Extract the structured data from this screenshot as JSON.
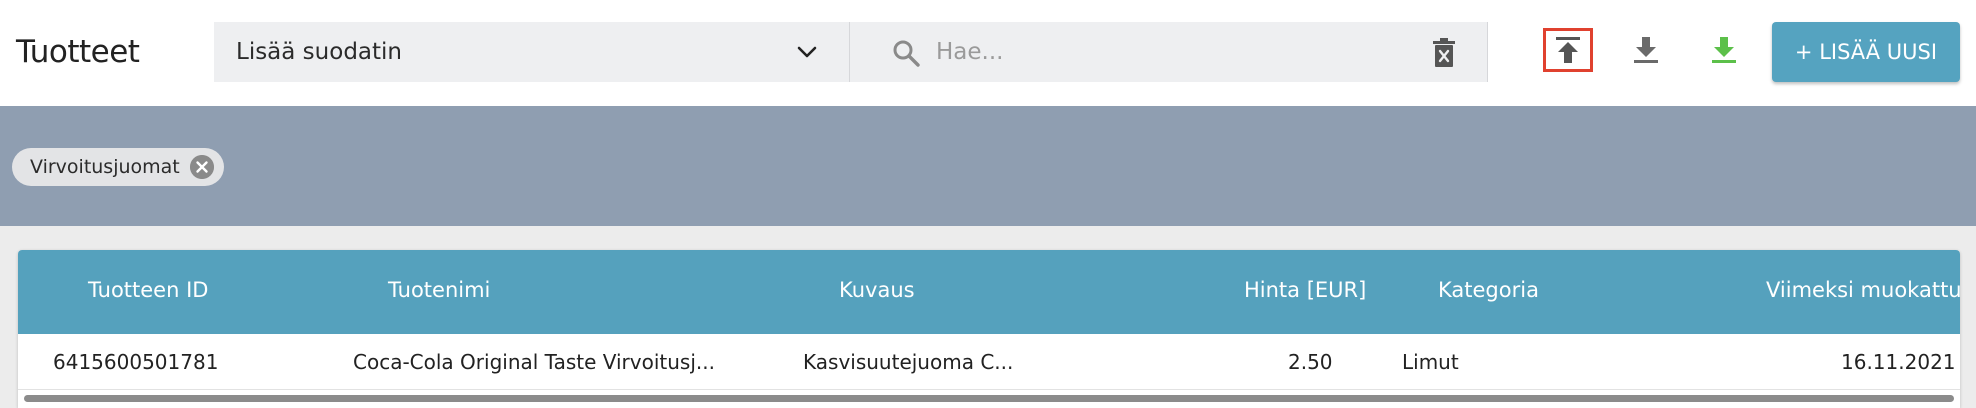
{
  "header": {
    "title": "Tuotteet",
    "filter_placeholder": "Lisää suodatin",
    "search_placeholder": "Hae...",
    "add_button_label": "+ LISÄÄ UUSI",
    "icons": [
      "chevron-down-icon",
      "search-icon",
      "trash-icon",
      "upload-icon",
      "download-icon",
      "download-icon"
    ],
    "colors": {
      "accent": "#55a3c0",
      "upload_highlight": "#e0412f",
      "green_download": "#5cc04a"
    }
  },
  "filters": {
    "chips": [
      {
        "label": "Virvoitusjuomat"
      }
    ]
  },
  "table": {
    "columns": [
      "Tuotteen ID",
      "Tuotenimi",
      "Kuvaus",
      "Hinta [EUR]",
      "Kategoria",
      "Viimeksi muokattu"
    ],
    "rows": [
      {
        "id": "6415600501781",
        "name": "Coca-Cola Original Taste Virvoitusj...",
        "description": "Kasvisuutejuoma C...",
        "price": "2.50",
        "category": "Limut",
        "modified": "16.11.2021"
      }
    ]
  }
}
